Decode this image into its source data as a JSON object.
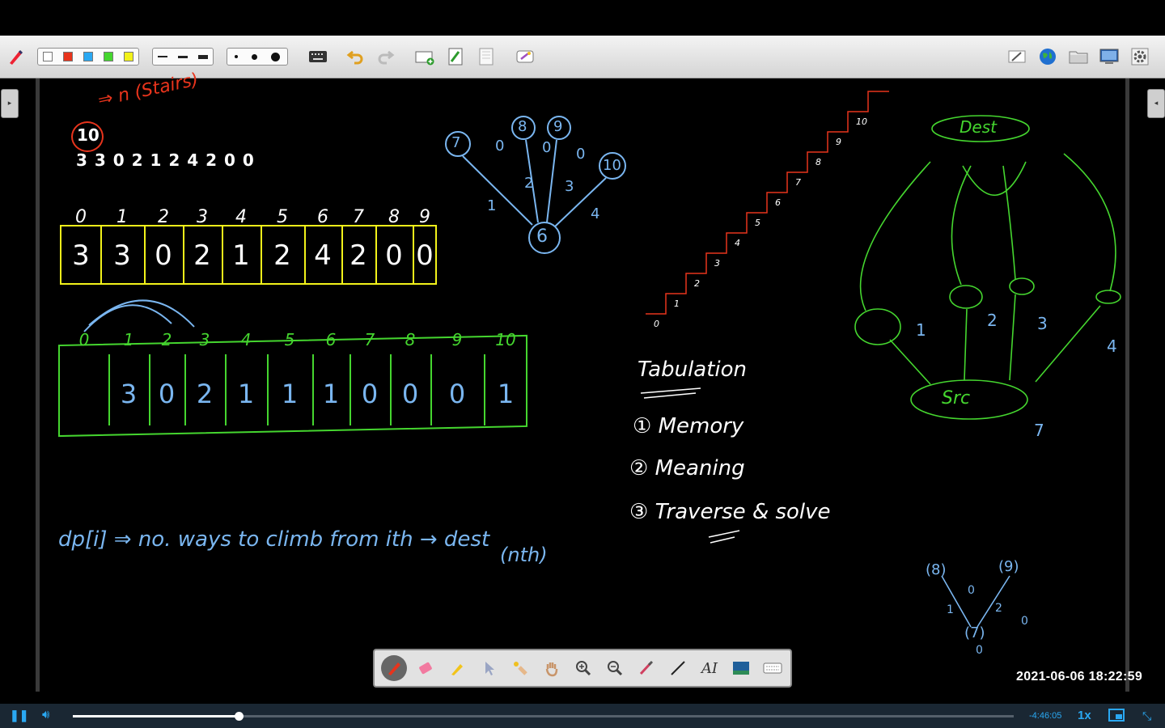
{
  "toolbar": {
    "colors": [
      "#ffffff",
      "#e8341c",
      "#2aa8f2",
      "#45d62f",
      "#f2f21a"
    ],
    "line_widths": [
      "thin",
      "medium",
      "thick"
    ],
    "dot_sizes": [
      "small",
      "medium",
      "large"
    ],
    "icons_left": [
      "keyboard-icon",
      "undo-icon",
      "redo-icon",
      "add-page-icon",
      "next-page-icon",
      "prev-page-icon",
      "magic-icon"
    ],
    "icons_right": [
      "edit-icon",
      "globe-icon",
      "folder-icon",
      "display-icon",
      "settings-icon"
    ]
  },
  "board": {
    "header_number": "10",
    "header_note": "⇒ n (Stairs)",
    "sequence": "3 3 0 2 1 2 4 2 0 0",
    "array1_indices": [
      "0",
      "1",
      "2",
      "3",
      "4",
      "5",
      "6",
      "7",
      "8",
      "9"
    ],
    "array1_values": [
      "3",
      "3",
      "0",
      "2",
      "1",
      "2",
      "4",
      "2",
      "0",
      "0"
    ],
    "array2_indices": [
      "0",
      "1",
      "2",
      "3",
      "4",
      "5",
      "6",
      "7",
      "8",
      "9",
      "10"
    ],
    "array2_values": [
      "",
      "3",
      "0",
      "2",
      "1",
      "1",
      "1",
      "0",
      "0",
      "0",
      "1"
    ],
    "dp_definition": "dp[i] ⇒ no. ways to climb from ith → dest",
    "dp_definition_sub": "(nth)",
    "tabulation_title": "Tabulation",
    "tabulation_items": [
      "① Memory",
      "② Meaning",
      "③ Traverse & solve"
    ],
    "graph_dest": "Dest",
    "graph_src": "Src",
    "graph_edge_labels": [
      "1",
      "2",
      "3",
      "4"
    ],
    "graph_src_to": "7",
    "tree_nodes": [
      "7",
      "8",
      "9",
      "10"
    ],
    "tree_root": "6",
    "tree_labels": [
      "0",
      "0",
      "0",
      "1",
      "2",
      "3",
      "4"
    ],
    "stair_labels": [
      "0",
      "1",
      "2",
      "3",
      "4",
      "5",
      "6",
      "7",
      "8",
      "9",
      "10"
    ],
    "mini_tree": [
      "(8)",
      "(9)",
      "(7)",
      "0",
      "1",
      "2",
      "0",
      "0"
    ]
  },
  "palette": {
    "tools": [
      "pen-icon",
      "eraser-icon",
      "highlighter-icon",
      "pointer-icon",
      "magic-hand-icon",
      "hand-icon",
      "zoom-in-icon",
      "zoom-out-icon",
      "brush-icon",
      "line-icon",
      "text-icon",
      "image-icon",
      "keyboard-icon"
    ]
  },
  "timestamp": "2021-06-06  18:22:59",
  "player": {
    "time_remaining": "-4:46:05",
    "speed": "1x",
    "progress": 0.176
  }
}
